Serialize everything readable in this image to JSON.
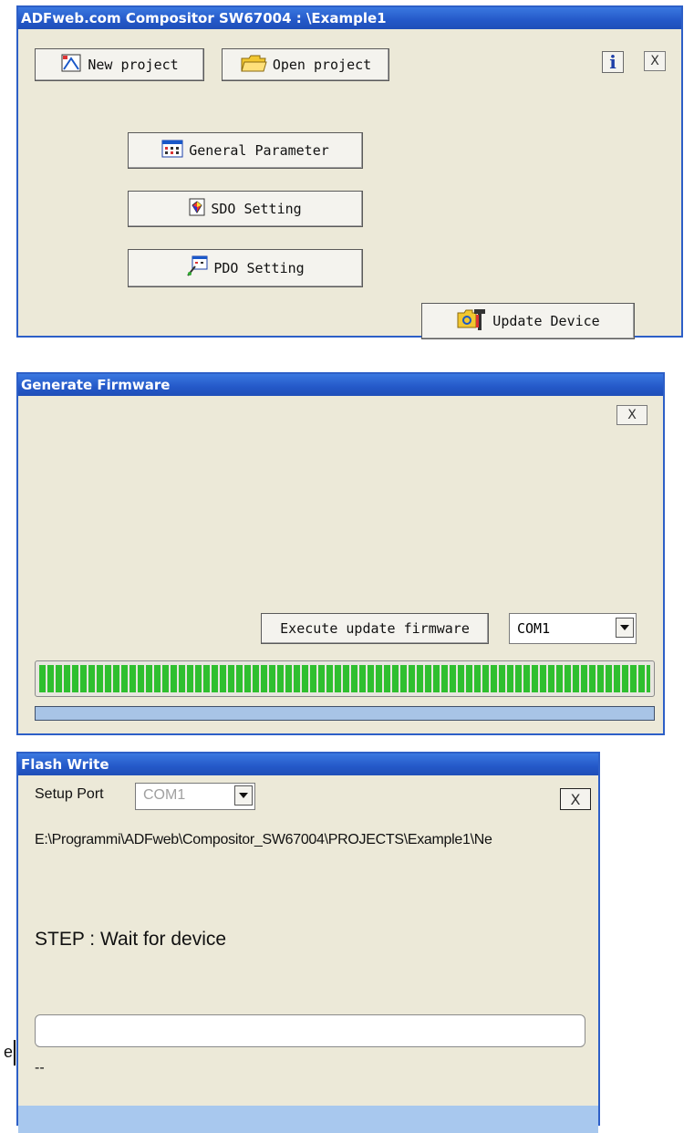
{
  "main_window": {
    "title": "ADFweb.com Compositor SW67004 : \\Example1",
    "new_project_label": "New project",
    "open_project_label": "Open project",
    "info_label": "i",
    "close_label": "X",
    "general_parameter_label": "General Parameter",
    "sdo_setting_label": "SDO Setting",
    "pdo_setting_label": "PDO Setting",
    "update_device_label": "Update Device"
  },
  "generate_firmware": {
    "title": "Generate Firmware",
    "close_label": "X",
    "execute_label": "Execute update firmware",
    "port_value": "COM1",
    "progress_fraction": 1.0
  },
  "flash_write": {
    "title": "Flash Write",
    "setup_port_label": "Setup Port",
    "port_value": "COM1",
    "close_label": "X",
    "path_text": "E:\\Programmi\\ADFweb\\Compositor_SW67004\\PROJECTS\\Example1\\Ne",
    "step_text": "STEP : Wait for device",
    "status_text": "--",
    "progress_fraction": 0.0
  },
  "side_fragment": "e"
}
